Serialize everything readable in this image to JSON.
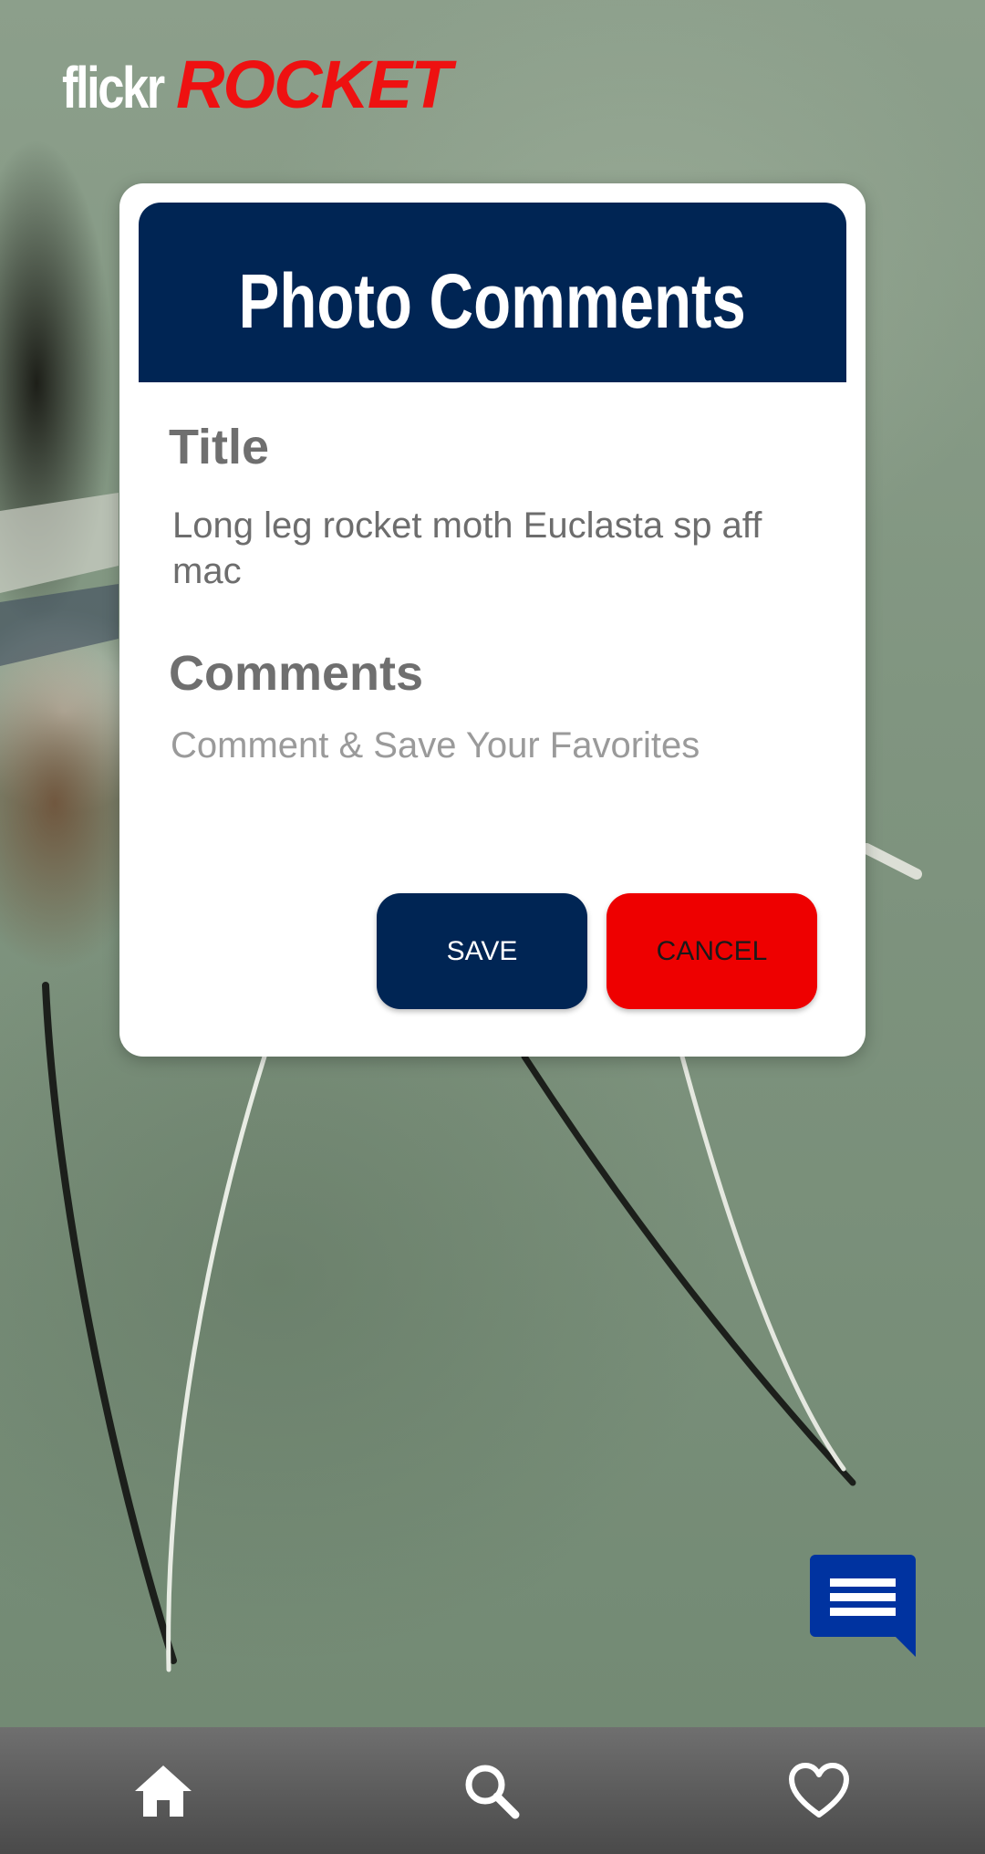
{
  "app": {
    "brand_part1": "flickr",
    "brand_part2": "ROCKET",
    "accent_color": "#ee1111",
    "primary_color": "#002554"
  },
  "dialog": {
    "title": "Photo Comments",
    "title_label": "Title",
    "title_value": "Long leg rocket moth Euclasta sp aff mac",
    "comments_label": "Comments",
    "comments_placeholder": "Comment & Save Your Favorites",
    "comments_value": "",
    "save_label": "SAVE",
    "cancel_label": "CANCEL"
  },
  "fab": {
    "icon": "comment-icon",
    "color": "#0033a0"
  },
  "bottom_nav": {
    "items": [
      {
        "icon": "home-icon"
      },
      {
        "icon": "search-icon"
      },
      {
        "icon": "heart-icon"
      }
    ]
  }
}
